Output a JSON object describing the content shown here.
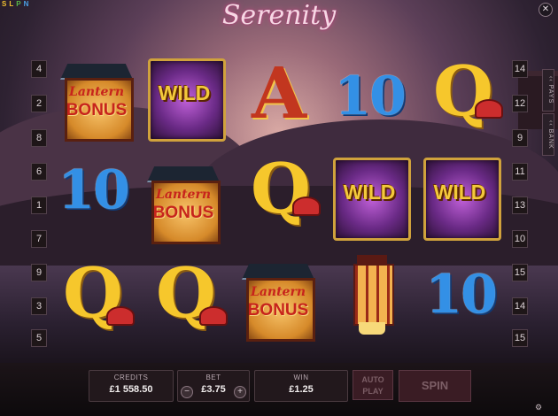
{
  "app": {
    "logo_letters": [
      "S",
      "L",
      "P",
      "N"
    ],
    "title": "Serenity",
    "close_glyph": "✕"
  },
  "paylines": {
    "left": [
      "4",
      "2",
      "8",
      "6",
      "1",
      "7",
      "9",
      "3",
      "5"
    ],
    "right": [
      "14",
      "12",
      "9",
      "11",
      "13",
      "10",
      "15",
      "14",
      "15"
    ]
  },
  "side_tabs": {
    "pays": "PAYS",
    "bank": "BANK"
  },
  "reels": [
    [
      "Lantern Bonus",
      "10",
      "Q"
    ],
    [
      "WILD",
      "Lantern Bonus",
      "Q"
    ],
    [
      "A",
      "Q",
      "Lantern Bonus"
    ],
    [
      "10",
      "WILD",
      "Lantern"
    ],
    [
      "Q",
      "WILD",
      "10"
    ]
  ],
  "bonus_symbol": {
    "line1": "Lantern",
    "line2": "BONUS"
  },
  "wild_label": "WILD",
  "bottom_bar": {
    "credits_label": "CREDITS",
    "credits_value": "£1 558.50",
    "bet_label": "BET",
    "bet_value": "£3.75",
    "bet_minus": "−",
    "bet_plus": "+",
    "win_label": "WIN",
    "win_value": "£1.25",
    "autoplay_label": "AUTO PLAY",
    "spin_label": "SPIN"
  },
  "colors": {
    "ten_blue": "#3390e6",
    "q_gold": "#f6c72c",
    "a_red": "#c2361f",
    "wild_purple": "#6a2a86",
    "bonus_red": "#c7241c"
  },
  "icons": [
    "close-icon",
    "pays-tab-arrow",
    "bank-tab-arrow",
    "settings-icon"
  ]
}
